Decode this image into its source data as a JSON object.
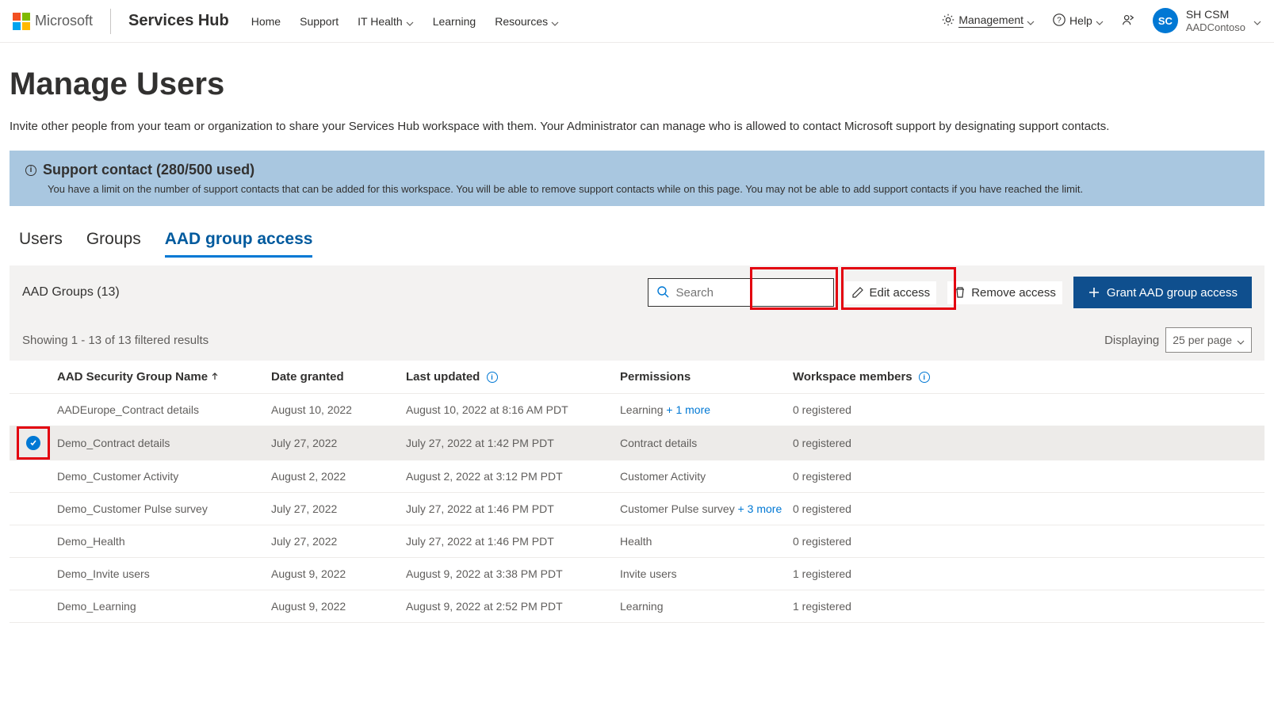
{
  "header": {
    "brand": "Microsoft",
    "app": "Services Hub",
    "nav": [
      "Home",
      "Support",
      "IT Health",
      "Learning",
      "Resources"
    ],
    "management": "Management",
    "help": "Help",
    "user_initials": "SC",
    "user_name": "SH CSM",
    "user_org": "AADContoso"
  },
  "page": {
    "title": "Manage Users",
    "description": "Invite other people from your team or organization to share your Services Hub workspace with them. Your Administrator can manage who is allowed to contact Microsoft support by designating support contacts."
  },
  "info": {
    "title": "Support contact (280/500 used)",
    "desc": "You have a limit on the number of support contacts that can be added for this workspace. You will be able to remove support contacts while on this page. You may not be able to add support contacts if you have reached the limit."
  },
  "tabs": {
    "users": "Users",
    "groups": "Groups",
    "aad": "AAD group access"
  },
  "toolbar": {
    "group_count": "AAD Groups (13)",
    "search_placeholder": "Search",
    "edit_access": "Edit access",
    "remove_access": "Remove access",
    "grant_access": "Grant AAD group access"
  },
  "results": {
    "showing": "Showing 1 - 13 of 13 filtered results",
    "displaying": "Displaying",
    "per_page": "25 per page"
  },
  "columns": {
    "name": "AAD Security Group Name",
    "date_granted": "Date granted",
    "last_updated": "Last updated",
    "permissions": "Permissions",
    "members": "Workspace members"
  },
  "rows": [
    {
      "name": "AADEurope_Contract details",
      "granted": "August 10, 2022",
      "updated": "August 10, 2022 at 8:16 AM PDT",
      "perm": "Learning",
      "more": "+ 1 more",
      "members": "0 registered",
      "selected": false
    },
    {
      "name": "Demo_Contract details",
      "granted": "July 27, 2022",
      "updated": "July 27, 2022 at 1:42 PM PDT",
      "perm": "Contract details",
      "more": "",
      "members": "0 registered",
      "selected": true
    },
    {
      "name": "Demo_Customer Activity",
      "granted": "August 2, 2022",
      "updated": "August 2, 2022 at 3:12 PM PDT",
      "perm": "Customer Activity",
      "more": "",
      "members": "0 registered",
      "selected": false
    },
    {
      "name": "Demo_Customer Pulse survey",
      "granted": "July 27, 2022",
      "updated": "July 27, 2022 at 1:46 PM PDT",
      "perm": "Customer Pulse survey",
      "more": "+ 3 more",
      "members": "0 registered",
      "selected": false
    },
    {
      "name": "Demo_Health",
      "granted": "July 27, 2022",
      "updated": "July 27, 2022 at 1:46 PM PDT",
      "perm": "Health",
      "more": "",
      "members": "0 registered",
      "selected": false
    },
    {
      "name": "Demo_Invite users",
      "granted": "August 9, 2022",
      "updated": "August 9, 2022 at 3:38 PM PDT",
      "perm": "Invite users",
      "more": "",
      "members": "1 registered",
      "selected": false
    },
    {
      "name": "Demo_Learning",
      "granted": "August 9, 2022",
      "updated": "August 9, 2022 at 2:52 PM PDT",
      "perm": "Learning",
      "more": "",
      "members": "1 registered",
      "selected": false
    }
  ]
}
